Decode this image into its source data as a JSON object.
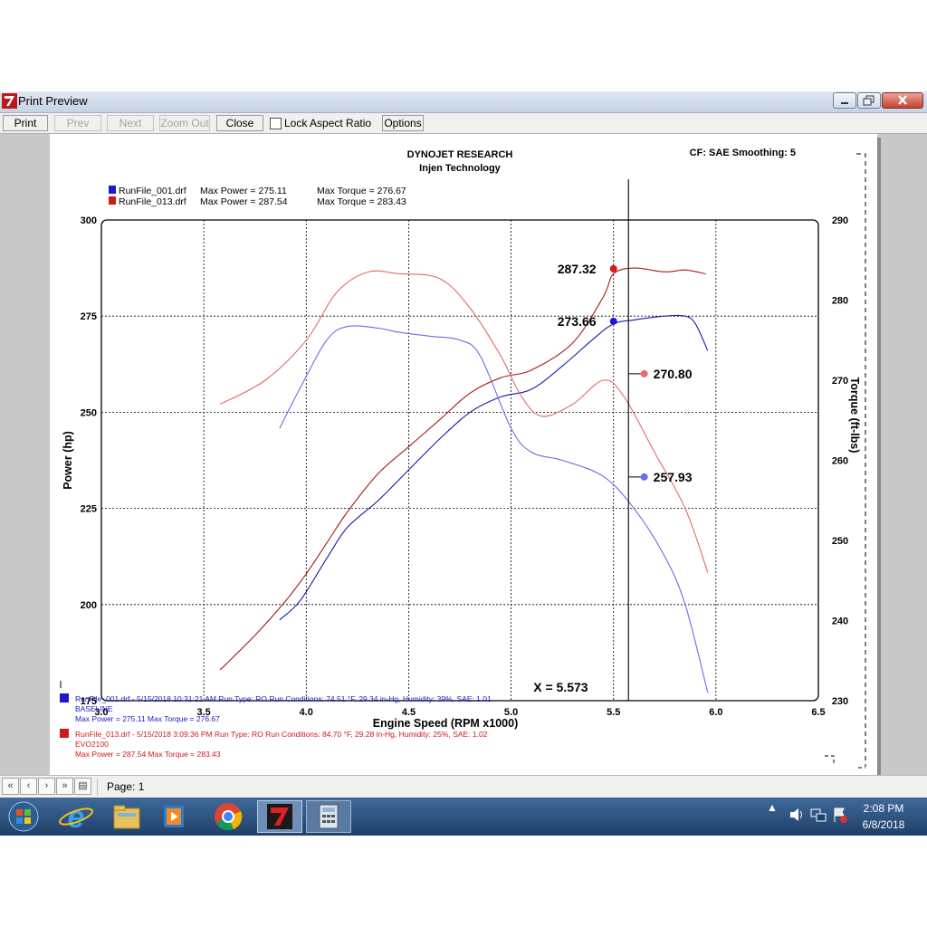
{
  "window": {
    "title": "Print Preview"
  },
  "toolbar": {
    "print": "Print",
    "prev": "Prev",
    "next": "Next",
    "zoom_out": "Zoom Out",
    "close": "Close",
    "lock_aspect": "Lock Aspect Ratio",
    "options": "Options"
  },
  "report": {
    "title": "DYNOJET RESEARCH",
    "subtitle": "Injen Technology",
    "cf_text": "CF: SAE  Smoothing: 5",
    "legend": [
      {
        "file": "RunFile_001.drf",
        "max_power": "Max Power = 275.11",
        "max_torque": "Max Torque = 276.67",
        "color": "#1a1acc"
      },
      {
        "file": "RunFile_013.drf",
        "max_power": "Max Power = 287.54",
        "max_torque": "Max Torque = 283.43",
        "color": "#cc1a1a"
      }
    ],
    "markers": {
      "red_power": "287.32",
      "blue_power": "273.66",
      "red_torque": "270.80",
      "blue_torque": "257.93"
    },
    "cursor": "X = 5.573",
    "runs": [
      {
        "line1": "RunFile_001.drf - 5/15/2018 10:31:21 AM  Run Type: RO  Run Conditions: 74.51 °F, 29.34 in-Hg,  Humidity:  39%, SAE: 1.01",
        "line2": "BASELINE",
        "line3": "Max Power = 275.11  Max Torque = 276.67",
        "color": "#1a1acc"
      },
      {
        "line1": "RunFile_013.drf - 5/15/2018 3:09:36 PM  Run Type: RO  Run Conditions: 84.70 °F, 29.28 in-Hg,  Humidity:  25%, SAE: 1.02",
        "line2": "EVO2100",
        "line3": "Max Power = 287.54  Max Torque = 283.43",
        "color": "#cc1a1a"
      }
    ]
  },
  "pager": {
    "label": "Page: 1"
  },
  "tray": {
    "time": "2:08 PM",
    "date": "6/8/2018"
  },
  "taskbar_icons": [
    "windows-start-icon",
    "internet-explorer-icon",
    "folder-icon",
    "media-player-icon",
    "chrome-icon",
    "dynojet-icon",
    "calculator-icon"
  ],
  "chart_data": {
    "type": "line",
    "xlabel": "Engine Speed (RPM x1000)",
    "ylabel": "Power (hp)",
    "y2label": "Torque (ft-lbs)",
    "xlim": [
      3.0,
      6.5
    ],
    "ylim": [
      175,
      300
    ],
    "y2lim": [
      230,
      290
    ],
    "x_ticks": [
      "3.0",
      "3.5",
      "4.0",
      "4.5",
      "5.0",
      "5.5",
      "6.0",
      "6.5"
    ],
    "y_ticks": [
      "175",
      "200",
      "225",
      "250",
      "275",
      "300"
    ],
    "y2_ticks": [
      "230",
      "240",
      "250",
      "260",
      "270",
      "280",
      "290"
    ],
    "cursor_x": 5.573,
    "series": [
      {
        "name": "RunFile_013.drf",
        "kind": "power",
        "axis": "left",
        "color": "#a81818",
        "points": [
          [
            3.58,
            183
          ],
          [
            3.75,
            192
          ],
          [
            3.9,
            201
          ],
          [
            4.0,
            208
          ],
          [
            4.1,
            216
          ],
          [
            4.2,
            224
          ],
          [
            4.35,
            234
          ],
          [
            4.5,
            241
          ],
          [
            4.65,
            248
          ],
          [
            4.8,
            255
          ],
          [
            4.95,
            259
          ],
          [
            5.1,
            261
          ],
          [
            5.3,
            268
          ],
          [
            5.45,
            280
          ],
          [
            5.5,
            286
          ],
          [
            5.6,
            287.5
          ],
          [
            5.75,
            286.5
          ],
          [
            5.85,
            287
          ],
          [
            5.95,
            286
          ]
        ]
      },
      {
        "name": "RunFile_001.drf",
        "kind": "power",
        "axis": "left",
        "color": "#1a1aa8",
        "points": [
          [
            3.87,
            196
          ],
          [
            3.97,
            201
          ],
          [
            4.1,
            212
          ],
          [
            4.2,
            220
          ],
          [
            4.35,
            227
          ],
          [
            4.5,
            235
          ],
          [
            4.65,
            243
          ],
          [
            4.8,
            250
          ],
          [
            4.95,
            254
          ],
          [
            5.1,
            256
          ],
          [
            5.25,
            262
          ],
          [
            5.4,
            269
          ],
          [
            5.5,
            273
          ],
          [
            5.6,
            274
          ],
          [
            5.75,
            275
          ],
          [
            5.85,
            275
          ],
          [
            5.9,
            273
          ],
          [
            5.96,
            266
          ]
        ]
      },
      {
        "name": "RunFile_013.drf",
        "kind": "torque",
        "axis": "right",
        "color": "#e36a6a",
        "points": [
          [
            3.58,
            267
          ],
          [
            3.8,
            270
          ],
          [
            4.0,
            275
          ],
          [
            4.15,
            281
          ],
          [
            4.3,
            283.5
          ],
          [
            4.45,
            283.3
          ],
          [
            4.65,
            282.7
          ],
          [
            4.8,
            279
          ],
          [
            4.95,
            273
          ],
          [
            5.05,
            268
          ],
          [
            5.15,
            265.5
          ],
          [
            5.3,
            267
          ],
          [
            5.45,
            270
          ],
          [
            5.55,
            268
          ],
          [
            5.7,
            261
          ],
          [
            5.85,
            254
          ],
          [
            5.96,
            246
          ]
        ]
      },
      {
        "name": "RunFile_001.drf",
        "kind": "torque",
        "axis": "right",
        "color": "#6a6ae3",
        "points": [
          [
            3.87,
            264
          ],
          [
            3.97,
            269
          ],
          [
            4.1,
            275
          ],
          [
            4.2,
            276.7
          ],
          [
            4.35,
            276.5
          ],
          [
            4.45,
            276
          ],
          [
            4.6,
            275.5
          ],
          [
            4.75,
            275
          ],
          [
            4.85,
            273
          ],
          [
            5.0,
            264
          ],
          [
            5.1,
            261
          ],
          [
            5.25,
            260
          ],
          [
            5.45,
            258
          ],
          [
            5.6,
            254
          ],
          [
            5.75,
            248
          ],
          [
            5.85,
            242
          ],
          [
            5.96,
            231
          ]
        ]
      }
    ]
  }
}
